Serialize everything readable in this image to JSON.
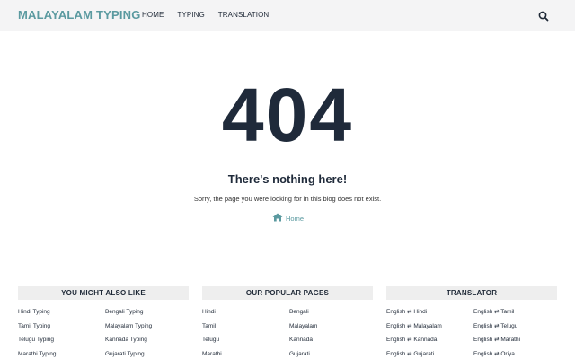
{
  "header": {
    "brand": "MALAYALAM TYPING",
    "nav": [
      "HOME",
      "TYPING",
      "TRANSLATION"
    ]
  },
  "error": {
    "code": "404",
    "title": "There's nothing here!",
    "message": "Sorry, the page you were looking for in this blog does not exist.",
    "home_label": "Home"
  },
  "widgets": [
    {
      "title": "YOU MIGHT ALSO LIKE",
      "links": [
        "Hindi Typing",
        "Bengali Typing",
        "Tamil Typing",
        "Malayalam Typing",
        "Telugu Typing",
        "Kannada Typing",
        "Marathi Typing",
        "Gujarati Typing"
      ]
    },
    {
      "title": "OUR POPULAR PAGES",
      "links": [
        "Hindi",
        "Bengali",
        "Tamil",
        "Malayalam",
        "Telugu",
        "Kannada",
        "Marathi",
        "Gujarati"
      ]
    },
    {
      "title": "TRANSLATOR",
      "links": [
        "English ⇄ Hindi",
        "English ⇄ Tamil",
        "English ⇄ Malayalam",
        "English ⇄ Telugu",
        "English ⇄ Kannada",
        "English ⇄ Marathi",
        "English ⇄ Gujarati",
        "English ⇄ Oriya"
      ]
    }
  ],
  "colors": {
    "accent": "#5b9aa0",
    "heading": "#1f2a3a",
    "header_bg": "#f4f4f5",
    "widget_head_bg": "#eeeeee"
  },
  "icons": {
    "search": "search-icon",
    "home": "home-icon"
  }
}
